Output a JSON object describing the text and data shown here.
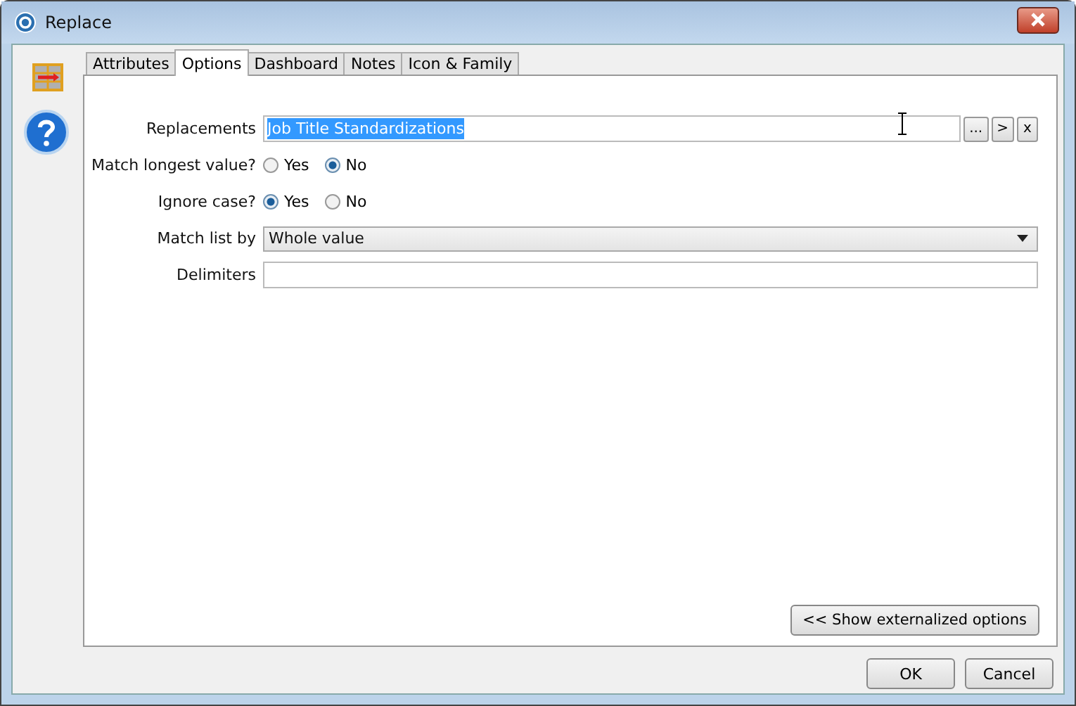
{
  "window": {
    "title": "Replace"
  },
  "tabs": [
    {
      "label": "Attributes",
      "selected": false
    },
    {
      "label": "Options",
      "selected": true
    },
    {
      "label": "Dashboard",
      "selected": false
    },
    {
      "label": "Notes",
      "selected": false
    },
    {
      "label": "Icon & Family",
      "selected": false
    }
  ],
  "fields": [
    {
      "kind": "text",
      "label": "Replacements",
      "value": "Job Title Standardizations",
      "text_selected": true,
      "buttons": [
        "...",
        ">",
        "x"
      ]
    },
    {
      "kind": "radio",
      "label": "Match longest value?",
      "options": [
        {
          "label": "Yes",
          "selected": false
        },
        {
          "label": "No",
          "selected": true
        }
      ]
    },
    {
      "kind": "radio",
      "label": "Ignore case?",
      "options": [
        {
          "label": "Yes",
          "selected": true
        },
        {
          "label": "No",
          "selected": false
        }
      ]
    },
    {
      "kind": "dropdown",
      "label": "Match list by",
      "value": "Whole value"
    },
    {
      "kind": "text",
      "label": "Delimiters"
    }
  ],
  "externalized_button": "<< Show externalized options",
  "buttons": [
    "OK",
    "Cancel"
  ]
}
